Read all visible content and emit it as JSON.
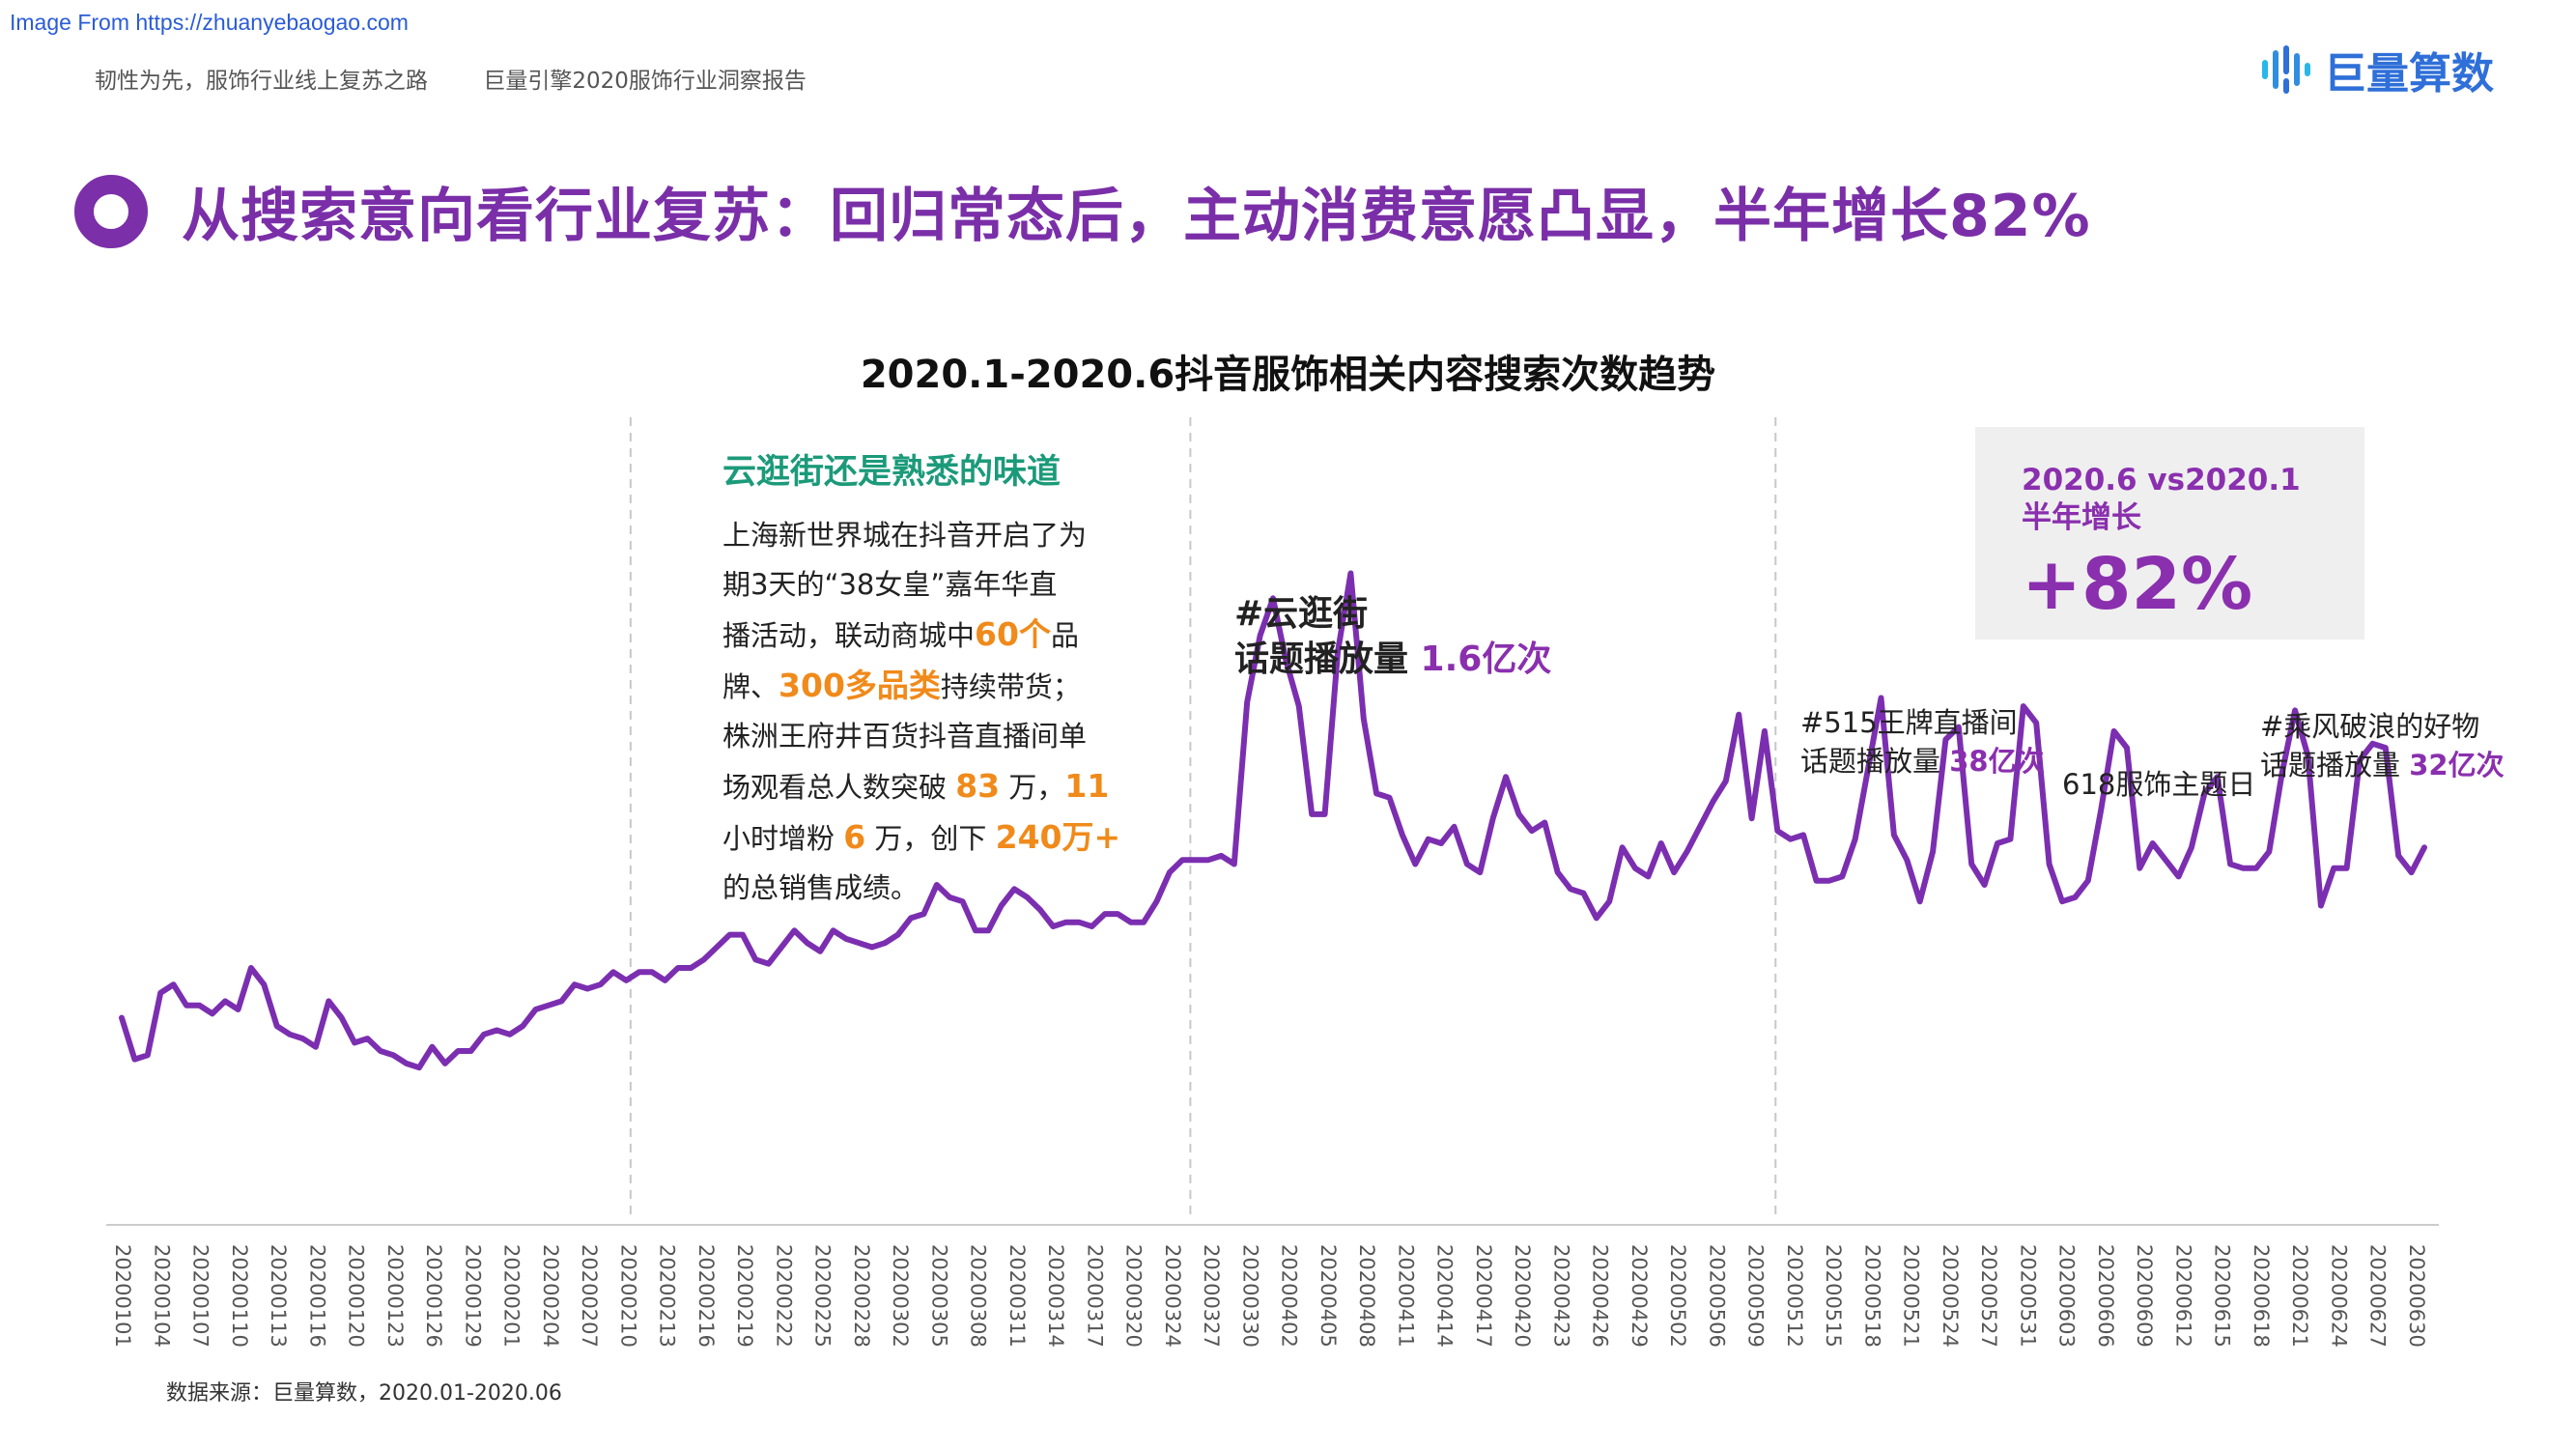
{
  "watermark": "Image From https://zhuanyebaogao.com",
  "breadcrumb": {
    "left": "韧性为先，服饰行业线上复苏之路",
    "right": "巨量引擎2020服饰行业洞察报告"
  },
  "logo": {
    "name": "巨量算数",
    "icon": "bar-logo-icon"
  },
  "headline": "从搜索意向看行业复苏：回归常态后，主动消费意愿凸显，半年增长82%",
  "colors": {
    "purple": "#7b2fa8",
    "accent": "#8a2fae",
    "orange": "#f08a1a",
    "green": "#1b9a7a",
    "line": "#7b2fb0"
  },
  "note": {
    "title": "云逛街还是熟悉的味道",
    "lines": [
      [
        {
          "t": "上海新世界城在抖音开启了为"
        }
      ],
      [
        {
          "t": "期3天的“38女皇”嘉年华直"
        }
      ],
      [
        {
          "t": "播活动，联动商城中"
        },
        {
          "t": "60个",
          "h": true
        },
        {
          "t": "品"
        }
      ],
      [
        {
          "t": "牌、"
        },
        {
          "t": "300多品类",
          "h": true
        },
        {
          "t": "持续带货；"
        }
      ],
      [
        {
          "t": "株洲王府井百货抖音直播间单"
        }
      ],
      [
        {
          "t": "场观看总人数突破 "
        },
        {
          "t": "83",
          "h": true
        },
        {
          "t": " 万，"
        },
        {
          "t": "11",
          "h": true
        }
      ],
      [
        {
          "t": "小时增粉 "
        },
        {
          "t": "6",
          "h": true
        },
        {
          "t": " 万，创下 "
        },
        {
          "t": "240万+",
          "h": true
        }
      ],
      [
        {
          "t": "的总销售成绩。"
        }
      ]
    ]
  },
  "annotations": {
    "a1": {
      "line1": "#云逛街",
      "line2": "话题播放量 ",
      "value": "1.6亿次"
    },
    "a2": {
      "line1": "#515王牌直播间",
      "line2": "话题播放量 ",
      "value": "38亿次"
    },
    "a3": {
      "line1": "618服饰主题日"
    },
    "a4": {
      "line1": "#乘风破浪的好物",
      "line2": "话题播放量 ",
      "value": "32亿次"
    }
  },
  "callout": {
    "label1": "2020.6 vs2020.1",
    "label2": "半年增长",
    "value": "+82%"
  },
  "source": "数据来源：巨量算数，2020.01-2020.06",
  "chart_data": {
    "type": "line",
    "title": "2020.1-2020.6抖音服饰相关内容搜索次数趋势",
    "x_tick_labels": [
      "20200101",
      "20200104",
      "20200107",
      "20200110",
      "20200113",
      "20200116",
      "20200120",
      "20200123",
      "20200126",
      "20200129",
      "20200201",
      "20200204",
      "20200207",
      "20200210",
      "20200213",
      "20200216",
      "20200219",
      "20200222",
      "20200225",
      "20200228",
      "20200302",
      "20200305",
      "20200308",
      "20200311",
      "20200314",
      "20200317",
      "20200320",
      "20200324",
      "20200327",
      "20200330",
      "20200402",
      "20200405",
      "20200408",
      "20200411",
      "20200414",
      "20200417",
      "20200420",
      "20200423",
      "20200426",
      "20200429",
      "20200502",
      "20200506",
      "20200509",
      "20200512",
      "20200515",
      "20200518",
      "20200521",
      "20200524",
      "20200527",
      "20200531",
      "20200603",
      "20200606",
      "20200609",
      "20200612",
      "20200615",
      "20200618",
      "20200621",
      "20200624",
      "20200627",
      "20200630"
    ],
    "y_axis_labels": "none",
    "y_units": "relative search index (no axis printed)",
    "ylim": [
      0,
      100
    ],
    "grid": false,
    "reference_lines": [
      "20200210",
      "20200325",
      "20200510"
    ],
    "series": [
      {
        "values": [
          24,
          19,
          19.5,
          27,
          28,
          25.5,
          25.5,
          24.5,
          26,
          25,
          30,
          28,
          23,
          22,
          21.5,
          20.5,
          26,
          24,
          21,
          21.5,
          20,
          19.5,
          18.5,
          18,
          20.5,
          18.5,
          20,
          20,
          22,
          22.5,
          22,
          23,
          25,
          25.5,
          26,
          28,
          27.5,
          28,
          29.5,
          28.5,
          29.5,
          29.5,
          28.5,
          30,
          30,
          31,
          32.5,
          34,
          34,
          31,
          30.5,
          32.5,
          34.5,
          33,
          32,
          34.5,
          33.5,
          33,
          32.5,
          33,
          34,
          36,
          36.5,
          40,
          38.5,
          38,
          34.5,
          34.5,
          37.5,
          39.5,
          38.5,
          37,
          35,
          35.5,
          35.5,
          35,
          36.5,
          36.5,
          35.5,
          35.5,
          38,
          41.5,
          43,
          43,
          43,
          43.5,
          42.5,
          62,
          70,
          74.5,
          67,
          61.5,
          48.5,
          48.5,
          68,
          77.5,
          60,
          51,
          50.5,
          46,
          42.5,
          45.5,
          45,
          47,
          42.5,
          41.5,
          48,
          53,
          48.5,
          46.5,
          47.5,
          41.5,
          39.5,
          39,
          36,
          38,
          44.5,
          42,
          41,
          45,
          41.5,
          44,
          47,
          50,
          52.5,
          60.5,
          48,
          58.5,
          46.5,
          45.5,
          46,
          40.5,
          40.5,
          41,
          45.5,
          54,
          62.5,
          46,
          43,
          38,
          44,
          57.5,
          59,
          42.5,
          40,
          45,
          45.5,
          61.5,
          59.5,
          42.5,
          38,
          38.5,
          40.5,
          49,
          58.5,
          56.5,
          42,
          45,
          43,
          41,
          44.5,
          51,
          53,
          42.5,
          42,
          42,
          44,
          53.5,
          61,
          55.5,
          37.5,
          42,
          42,
          55,
          57,
          56.5,
          43.5,
          41.5,
          44.5
        ]
      }
    ]
  }
}
